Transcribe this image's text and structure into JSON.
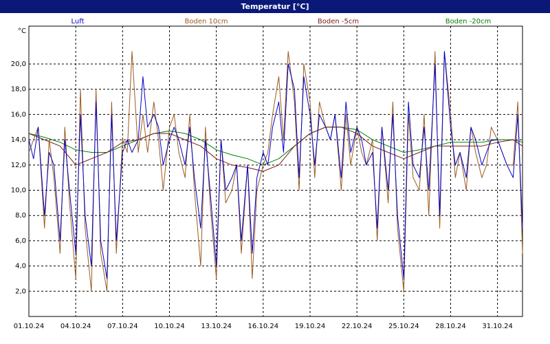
{
  "window": {
    "title": "Temperatur [°C]"
  },
  "chart_data": {
    "type": "line",
    "title": "Temperatur [°C]",
    "ylabel": "°C",
    "xlabel": "",
    "ylim": [
      0,
      23
    ],
    "xlim": [
      0,
      31.6
    ],
    "grid": true,
    "legend_position": "top",
    "y_ticks": [
      "2,0",
      "4,0",
      "6,0",
      "8,0",
      "10,0",
      "12,0",
      "14,0",
      "16,0",
      "18,0",
      "20,0"
    ],
    "y_tick_values": [
      2,
      4,
      6,
      8,
      10,
      12,
      14,
      16,
      18,
      20
    ],
    "x_ticks": [
      "01.10.24",
      "04.10.24",
      "07.10.24",
      "10.10.24",
      "13.10.24",
      "16.10.24",
      "19.10.24",
      "22.10.24",
      "25.10.24",
      "28.10.24",
      "31.10.24"
    ],
    "x_tick_values": [
      0,
      3,
      6,
      9,
      12,
      15,
      18,
      21,
      24,
      27,
      30
    ],
    "series": [
      {
        "name": "Luft",
        "color": "#0000c8",
        "x": [
          0,
          0.3,
          0.6,
          1,
          1.3,
          1.6,
          2,
          2.3,
          2.6,
          3,
          3.3,
          3.6,
          4,
          4.3,
          4.6,
          5,
          5.3,
          5.6,
          6,
          6.3,
          6.6,
          7,
          7.3,
          7.6,
          8,
          8.3,
          8.6,
          9,
          9.3,
          9.6,
          10,
          10.3,
          10.6,
          11,
          11.3,
          11.6,
          12,
          12.3,
          12.6,
          13,
          13.3,
          13.6,
          14,
          14.3,
          14.6,
          15,
          15.3,
          15.6,
          16,
          16.3,
          16.6,
          17,
          17.3,
          17.6,
          18,
          18.3,
          18.6,
          19,
          19.3,
          19.6,
          20,
          20.3,
          20.6,
          21,
          21.3,
          21.6,
          22,
          22.3,
          22.6,
          23,
          23.3,
          23.6,
          24,
          24.3,
          24.6,
          25,
          25.3,
          25.6,
          26,
          26.3,
          26.6,
          27,
          27.3,
          27.6,
          28,
          28.3,
          28.6,
          29,
          29.3,
          29.6,
          30,
          30.3,
          30.6,
          31,
          31.3,
          31.6
        ],
        "values": [
          14,
          12.5,
          15,
          8,
          13,
          12,
          6,
          14,
          10,
          5,
          16,
          8,
          4,
          17,
          6,
          3,
          16,
          6,
          13,
          14,
          13,
          14,
          19,
          15,
          16,
          15,
          12,
          14,
          15,
          14,
          12,
          15,
          11,
          7,
          14,
          10,
          4,
          14,
          10,
          11,
          12,
          6,
          12,
          5,
          11,
          13,
          12,
          15,
          17,
          13,
          20,
          18,
          11,
          19,
          16,
          12,
          16,
          15,
          14,
          16,
          11,
          17,
          13,
          15,
          14,
          12,
          13,
          7,
          15,
          10,
          16,
          8,
          3,
          17,
          12,
          11,
          15,
          10,
          20,
          8,
          21,
          15,
          12,
          13,
          11,
          15,
          14,
          12,
          13,
          14,
          14,
          13,
          12,
          11,
          16,
          7
        ],
        "line_width": 1
      },
      {
        "name": "Boden 10cm",
        "color": "#9a5a1e",
        "x": [
          0,
          0.3,
          0.6,
          1,
          1.3,
          1.6,
          2,
          2.3,
          2.6,
          3,
          3.3,
          3.6,
          4,
          4.3,
          4.6,
          5,
          5.3,
          5.6,
          6,
          6.3,
          6.6,
          7,
          7.3,
          7.6,
          8,
          8.3,
          8.6,
          9,
          9.3,
          9.6,
          10,
          10.3,
          10.6,
          11,
          11.3,
          11.6,
          12,
          12.3,
          12.6,
          13,
          13.3,
          13.6,
          14,
          14.3,
          14.6,
          15,
          15.3,
          15.6,
          16,
          16.3,
          16.6,
          17,
          17.3,
          17.6,
          18,
          18.3,
          18.6,
          19,
          19.3,
          19.6,
          20,
          20.3,
          20.6,
          21,
          21.3,
          21.6,
          22,
          22.3,
          22.6,
          23,
          23.3,
          23.6,
          24,
          24.3,
          24.6,
          25,
          25.3,
          25.6,
          26,
          26.3,
          26.6,
          27,
          27.3,
          27.6,
          28,
          28.3,
          28.6,
          29,
          29.3,
          29.6,
          30,
          30.3,
          30.6,
          31,
          31.3,
          31.6
        ],
        "values": [
          13,
          14,
          15,
          7,
          14,
          11,
          5,
          15,
          9,
          3,
          18,
          7,
          2,
          18,
          5,
          2,
          17,
          5,
          14,
          13,
          21,
          13,
          16,
          13,
          17,
          14,
          10,
          15,
          16,
          13,
          11,
          16,
          10,
          4,
          15,
          9,
          3,
          14,
          9,
          10,
          12,
          5,
          12,
          3,
          10,
          12,
          13,
          16,
          19,
          14,
          21,
          17,
          10,
          20,
          17,
          11,
          17,
          15,
          14,
          16,
          10,
          16,
          12,
          15,
          13,
          12,
          14,
          6,
          15,
          9,
          17,
          7,
          2,
          16,
          11,
          10,
          16,
          8,
          21,
          7,
          21,
          16,
          11,
          13,
          10,
          15,
          13,
          11,
          12,
          15,
          14,
          13,
          12,
          12,
          17,
          5
        ],
        "line_width": 1
      },
      {
        "name": "Boden -5cm",
        "color": "#7a1a12",
        "x": [
          0,
          1,
          2,
          3,
          4,
          5,
          6,
          7,
          8,
          9,
          10,
          11,
          12,
          13,
          14,
          15,
          16,
          17,
          18,
          19,
          20,
          21,
          22,
          23,
          24,
          25,
          26,
          27,
          28,
          29,
          30,
          31,
          31.6
        ],
        "values": [
          14.5,
          14,
          13.5,
          12,
          12.5,
          13,
          13.8,
          14,
          14.5,
          14.5,
          14,
          13.5,
          12.5,
          12,
          11.8,
          11.5,
          12,
          13.5,
          14.5,
          15,
          15,
          14.5,
          13.5,
          13,
          12.5,
          13,
          13.5,
          13.5,
          13.5,
          13.5,
          13.8,
          14,
          13.5
        ],
        "line_width": 1
      },
      {
        "name": "Boden -20cm",
        "color": "#008000",
        "x": [
          0,
          1,
          2,
          3,
          4,
          5,
          6,
          7,
          8,
          9,
          10,
          11,
          12,
          13,
          14,
          15,
          16,
          17,
          18,
          19,
          20,
          21,
          22,
          23,
          24,
          25,
          26,
          27,
          28,
          29,
          30,
          31,
          31.6
        ],
        "values": [
          14.5,
          14.2,
          13.8,
          13.2,
          13,
          13,
          13.5,
          14,
          14.5,
          14.7,
          14.5,
          14,
          13.2,
          12.8,
          12.5,
          12,
          12.5,
          13.5,
          14.5,
          15,
          15,
          14.8,
          14,
          13.5,
          13,
          13.2,
          13.5,
          13.8,
          13.8,
          13.8,
          14,
          14,
          13.8
        ],
        "line_width": 1
      }
    ]
  }
}
